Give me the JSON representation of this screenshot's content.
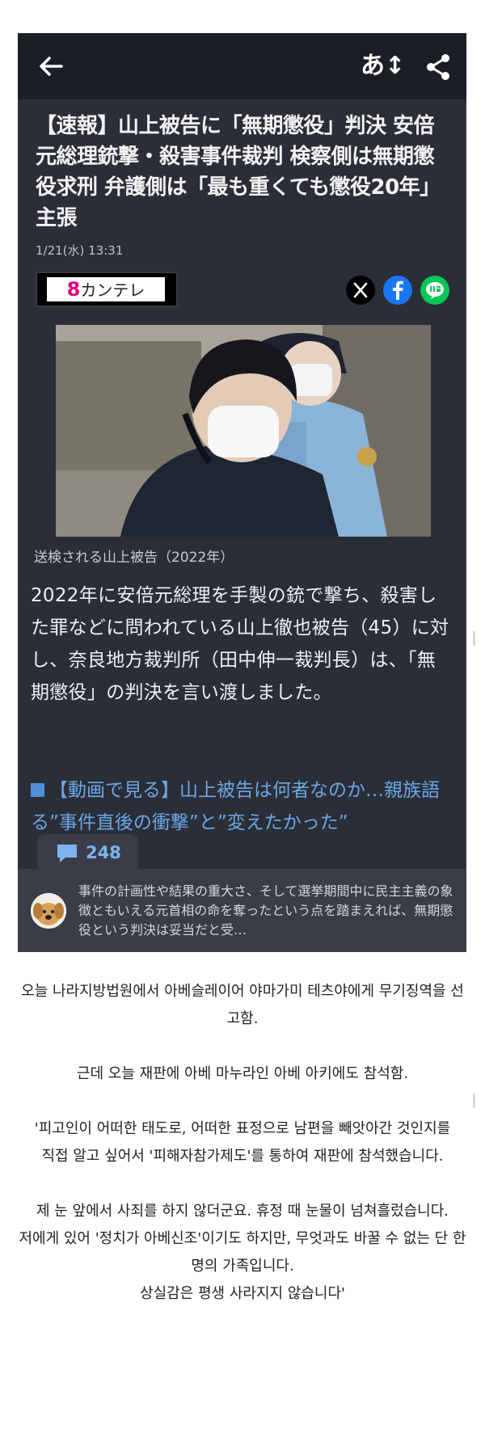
{
  "app": {
    "font_size_button": "あ↕",
    "icons": [
      "back-arrow-icon",
      "font-size-icon",
      "share-icon",
      "x-icon",
      "facebook-icon",
      "line-icon",
      "comment-icon"
    ]
  },
  "article": {
    "headline": "【速報】山上被告に「無期懲役」判決 安倍元総理銃撃・殺害事件裁判 検察側は無期懲役求刑 弁護側は「最も重くても懲役20年」主張",
    "timestamp": "1/21(水) 13:31",
    "source": {
      "logo_number": "8",
      "logo_text": "カンテレ"
    },
    "photo_caption": "送検される山上被告（2022年）",
    "body": "2022年に安倍元総理を手製の銃で撃ち、殺害した罪などに問われている山上徹也被告（45）に対し、奈良地方裁判所（田中伸一裁判長）は、「無期懲役」の判決を言い渡しました。",
    "related_link": "【動画で見る】山上被告は何者なのか…親族語る”事件直後の衝撃”と”変えたかった”",
    "related_link_tail": "…"
  },
  "comments": {
    "count": "248",
    "preview": "事件の計画性や結果の重大さ、そして選挙期間中に民主主義の象徴ともいえる元首相の命を奪ったという点を踏まえれば、無期懲役という判決は妥当だと受…"
  },
  "korean_text": {
    "p1": "오늘 나라지방법원에서 아베슬레이어 야마가미 테츠야에게 무기징역을 선고함.",
    "p2": "근데 오늘 재판에 아베 마누라인 아베 아키에도 참석함.",
    "q1": "'피고인이 어떠한 태도로, 어떠한 표정으로 남편을 빼앗아간 것인지를",
    "q2": "직접 알고 싶어서 '피해자참가제도'를 통하여 재판에 참석했습니다.",
    "q3": "제 눈 앞에서 사죄를 하지 않더군요. 휴정 때 눈물이 넘쳐흘렀습니다.",
    "q4": "저에게 있어 '정치가 아베신조'이기도 하지만, 무엇과도 바꿀 수 없는 단 한명의 가족입니다.",
    "q5": "상실감은 평생 사라지지 않습니다'"
  },
  "colors": {
    "app_background": "#2b2e37",
    "top_bar": "#1c1e25",
    "link": "#6aa7e6",
    "facebook": "#1877f2",
    "line": "#06c755",
    "brand_pink": "#e4007f"
  }
}
